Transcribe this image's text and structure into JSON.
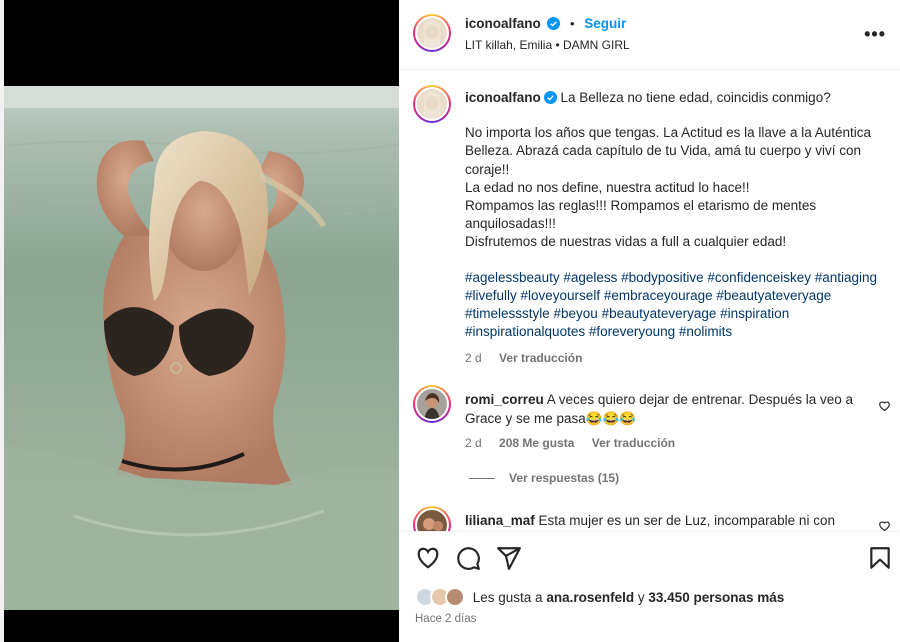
{
  "header": {
    "username": "iconoalfano",
    "separator": "•",
    "follow_label": "Seguir",
    "audio": "LIT killah, Emilia • DAMN GIRL",
    "more": "•••"
  },
  "caption": {
    "username": "iconoalfano",
    "title": "La Belleza no tiene edad, coincidis conmigo?",
    "paragraph": [
      "No importa los años que tengas. La Actitud es la llave a la Auténtica Belleza. Abrazá cada capítulo de tu Vida, amá tu cuerpo y viví con coraje!!",
      "La edad no nos define, nuestra actitud lo hace!!",
      "Rompamos las reglas!!! Rompamos el etarismo de mentes anquilosadas!!!",
      "Disfrutemos de nuestras vidas a full a cualquier edad!"
    ],
    "hashtags": "#agelessbeauty #ageless #bodypositive #confidenceiskey #antiaging #livefully #loveyourself #embraceyourage #beautyateveryage #timelessstyle #beyou #beautyateveryage #inspiration #inspirationalquotes #foreveryoung #nolimits",
    "age": "2 d",
    "translate": "Ver traducción"
  },
  "comments": [
    {
      "username": "romi_correu",
      "text": "A veces quiero dejar de entrenar. Después la veo a Grace y se me pasa😂😂😂",
      "age": "2 d",
      "likes": "208 Me gusta",
      "translate": "Ver traducción",
      "replies": "Ver respuestas (15)"
    },
    {
      "username": "liliana_maf",
      "text": "Esta mujer es un ser de Luz, incomparable ni con nadie 😍😍😍"
    }
  ],
  "footer": {
    "likes_prefix": "Les gusta a",
    "likes_user": "ana.rosenfeld",
    "likes_connector": "y",
    "likes_count": "33.450 personas más",
    "time": "Hace 2 días"
  },
  "colors": {
    "link": "#0095f6",
    "hashtag": "#00376b",
    "muted": "#737373",
    "verified": "#0095f6"
  }
}
